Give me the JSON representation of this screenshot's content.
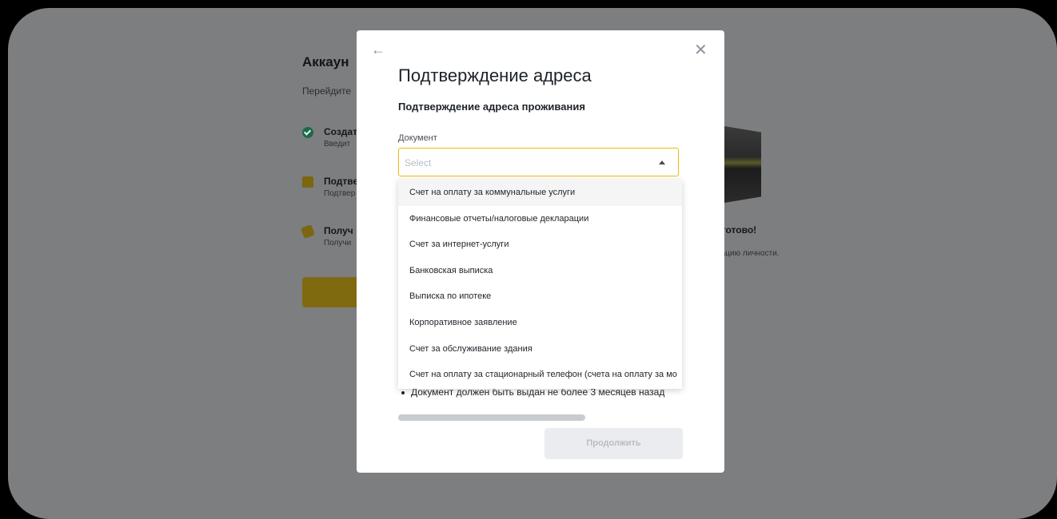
{
  "background": {
    "title": "Аккаун",
    "subtitle": "Перейдите",
    "steps": [
      {
        "title": "Создат",
        "desc": "Введит"
      },
      {
        "title": "Подтве",
        "desc": "Подтвер"
      },
      {
        "title": "Получ",
        "desc": "Получи"
      }
    ],
    "ready_title": "се готово!",
    "ready_desc": "рикацию личности."
  },
  "modal": {
    "back_icon": "←",
    "close_icon": "✕",
    "title": "Подтверждение адреса",
    "subtitle": "Подтверждение адреса проживания",
    "document_label": "Документ",
    "select_placeholder": "Select",
    "options": [
      "Счет на оплату за коммунальные услуги",
      "Финансовые отчеты/налоговые декларации",
      "Счет за интернет-услуги",
      "Банковская выписка",
      "Выписка по ипотеке",
      "Корпоративное заявление",
      "Счет за обслуживание здания",
      "Счет на оплату за стационарный телефон (счета на оплату за мо"
    ],
    "requirement": "Документ должен быть выдан не более 3 месяцев назад",
    "continue_label": "Продолжить"
  },
  "colors": {
    "accent": "#f0b90b",
    "overlay": "#7d7e80",
    "text": "#1e2329"
  }
}
